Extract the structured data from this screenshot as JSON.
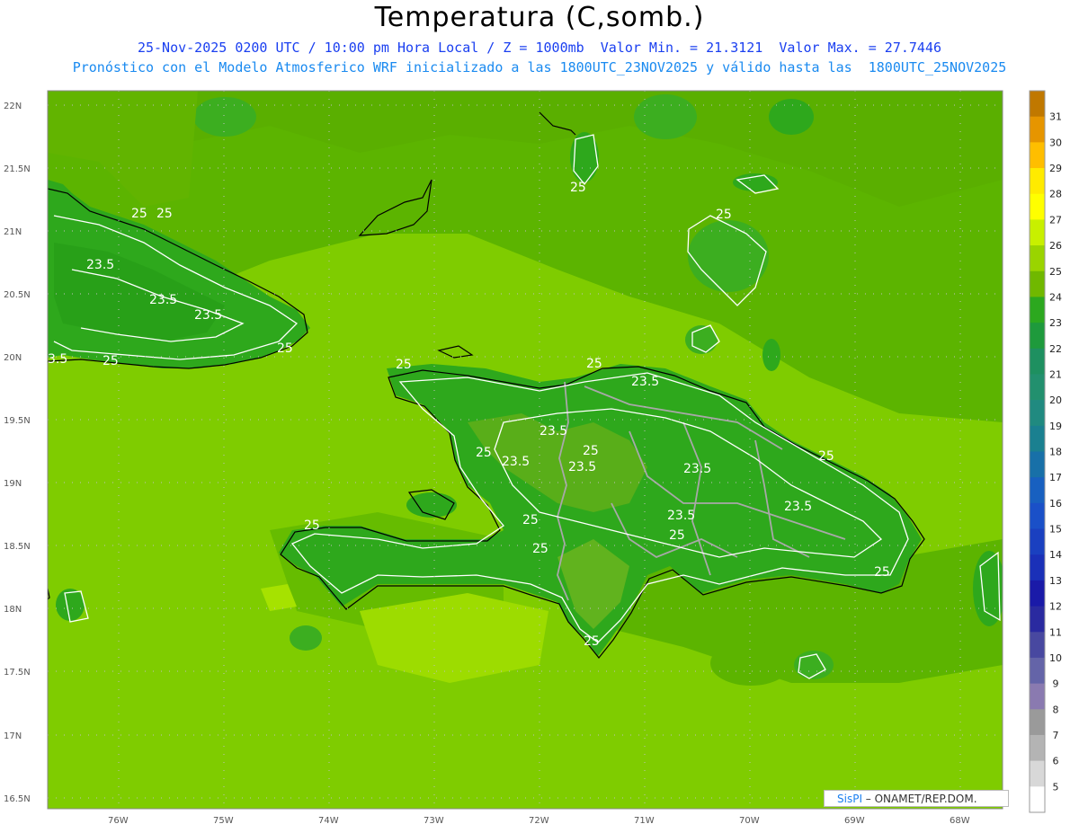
{
  "header": {
    "title": "Temperatura (C,somb.)",
    "line1": "25-Nov-2025 0200 UTC / 10:00 pm Hora Local / Z = 1000mb  Valor Min. = 21.3121  Valor Max. = 27.7446",
    "line2": "Pronóstico con el Modelo Atmosferico WRF inicializado a las 1800UTC_23NOV2025 y válido hasta las  1800UTC_25NOV2025"
  },
  "axes": {
    "lat_labels": [
      "22N",
      "21.5N",
      "21N",
      "20.5N",
      "20N",
      "19.5N",
      "19N",
      "18.5N",
      "18N",
      "17.5N",
      "17N",
      "16.5N"
    ],
    "lon_labels": [
      "76W",
      "75W",
      "74W",
      "73W",
      "72W",
      "71W",
      "70W",
      "69W",
      "68W"
    ]
  },
  "contour_labels": [
    "25",
    "25",
    "23.5",
    "23.5",
    "23.5",
    "3.5",
    "25",
    "25",
    "25",
    "23.5",
    "23.5",
    "23.5",
    "25",
    "23.5",
    "25",
    "23.5",
    "23.5",
    "23.5",
    "25",
    "25",
    "25",
    "25",
    "25",
    "25",
    "25",
    "25",
    "25",
    "25"
  ],
  "colorbar": {
    "values": [
      "31",
      "30",
      "29",
      "28",
      "27",
      "26",
      "25",
      "24",
      "23",
      "22",
      "21",
      "20",
      "19",
      "18",
      "17",
      "16",
      "15",
      "14",
      "13",
      "12",
      "11",
      "10",
      "9",
      "8",
      "7",
      "6",
      "5"
    ],
    "colors": [
      "#c07800",
      "#e69500",
      "#ffbe00",
      "#ffeb00",
      "#ffff00",
      "#c8f000",
      "#9ad400",
      "#70b800",
      "#2ca81f",
      "#1e9a3c",
      "#1e9060",
      "#22906e",
      "#208a80",
      "#1a8090",
      "#1870a8",
      "#1860c0",
      "#1a50c8",
      "#1a40c0",
      "#1a30b8",
      "#1a1aa8",
      "#2a2aa0",
      "#4848a0",
      "#6464a8",
      "#8a7ab0",
      "#9a9a9a",
      "#b4b4b4",
      "#d8d8d8",
      "#ffffff"
    ]
  },
  "credit": {
    "brand": "SisPI",
    "text": " – ONAMET/REP.DOM."
  }
}
